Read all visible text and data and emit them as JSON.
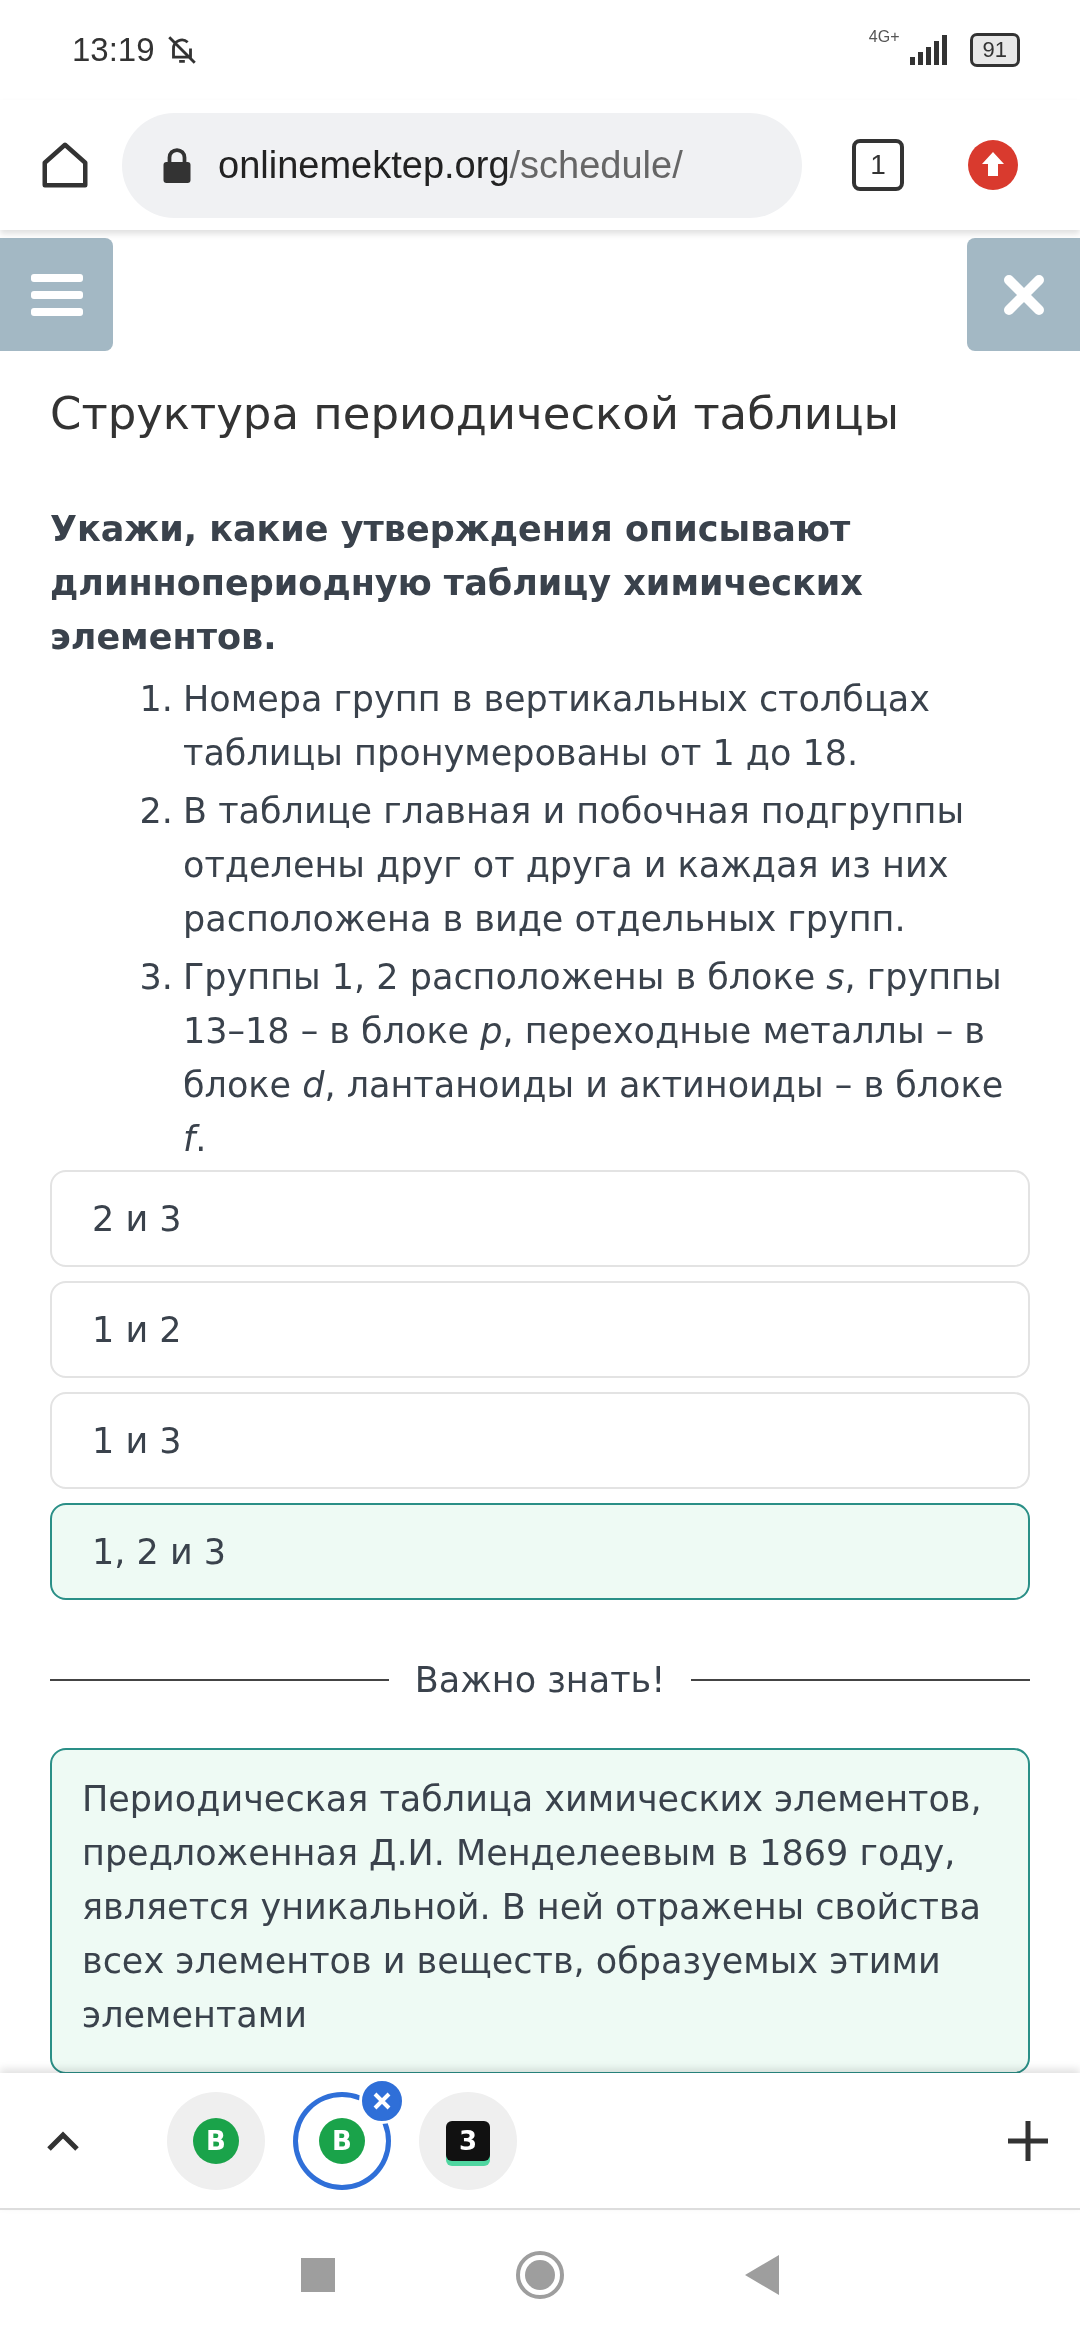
{
  "status_bar": {
    "time": "13:19",
    "network": "4G+",
    "battery": "91"
  },
  "browser": {
    "url_host": "onlinemektep.org",
    "url_path": "/schedule/",
    "tab_count": "1"
  },
  "page": {
    "title": "Структура периодической таблицы",
    "question": "Укажи, какие утверждения описывают длиннопериодную таблицу химических элементов.",
    "statements": [
      {
        "number": "1.",
        "text": "Номера групп в вертикальных столбцах таблицы пронумерованы от 1 до 18."
      },
      {
        "number": "2.",
        "text": "В таблице главная и побочная подгруппы отделены друг от друга и каждая из них расположена в виде отдельных групп."
      },
      {
        "number": "3.",
        "text": "Группы 1, 2 расположены в блоке *s*, группы 13–18 – в блоке *p*, переходные металлы – в блоке *d*, лантаноиды и актиноиды – в блоке *f*."
      }
    ],
    "options": [
      {
        "label": "2 и 3",
        "selected": false
      },
      {
        "label": "1 и 2",
        "selected": false
      },
      {
        "label": "1 и 3",
        "selected": false
      },
      {
        "label": "1, 2 и 3",
        "selected": true
      }
    ],
    "divider_label": "Важно знать!",
    "info": "Периодическая таблица химических элементов, предложенная Д.И. Менделеевым в 1869 году, является уникальной. В ней отражены свойства всех элементов и веществ, образуемых этими элементами"
  },
  "tab_strip": {
    "tabs": [
      {
        "kind": "green-b",
        "label": "B",
        "selected": false
      },
      {
        "kind": "green-b",
        "label": "B",
        "selected": true
      },
      {
        "kind": "dark-badge",
        "label": "3",
        "selected": false
      }
    ]
  }
}
